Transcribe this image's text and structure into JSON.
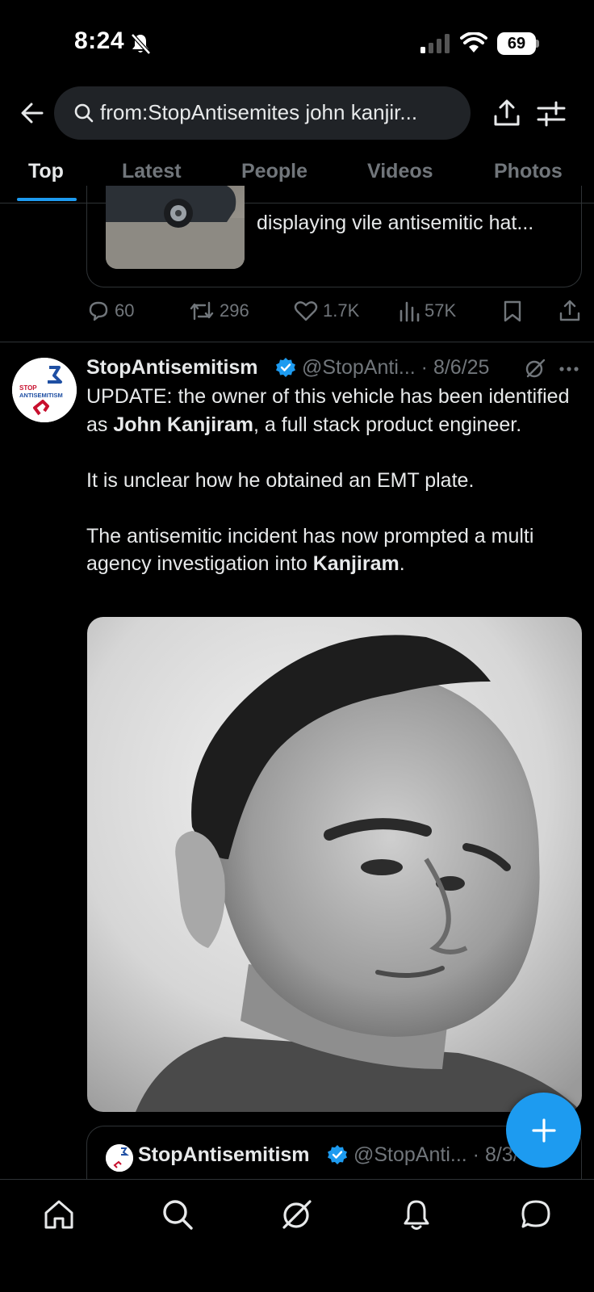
{
  "status_bar": {
    "time": "8:24",
    "battery": "69"
  },
  "search": {
    "query": "from:StopAntisemites john kanjir..."
  },
  "tabs": [
    {
      "label": "Top",
      "active": true
    },
    {
      "label": "Latest",
      "active": false
    },
    {
      "label": "People",
      "active": false
    },
    {
      "label": "Videos",
      "active": false
    },
    {
      "label": "Photos",
      "active": false
    }
  ],
  "previous_tweet": {
    "card_text": "displaying vile antisemitic hat...",
    "replies": "60",
    "reposts": "296",
    "likes": "1.7K",
    "views": "57K"
  },
  "tweet": {
    "display_name": "StopAntisemitism",
    "handle_date": "@StopAnti... · 8/6/25",
    "body": {
      "p1_a": "UPDATE: the owner of this vehicle has been identified as ",
      "p1_bold": "John Kanjiram",
      "p1_b": ", a full stack product engineer.",
      "p2": "It is unclear how he obtained an EMT plate.",
      "p3_a": "The antisemitic incident has now prompted a multi agency investigation into ",
      "p3_bold": "Kanjiram",
      "p3_b": "."
    },
    "avatar_text": [
      "STOP",
      "ANTISEMITISM"
    ]
  },
  "quoted_tweet": {
    "display_name": "StopAntisemitism",
    "handle_date": "@StopAnti... · 8/3/"
  },
  "icons": [
    "back-arrow-icon",
    "search-icon",
    "share-icon",
    "filter-icon",
    "verified-badge-icon",
    "grok-icon",
    "more-icon",
    "reply-icon",
    "repost-icon",
    "like-icon",
    "views-icon",
    "bookmark-icon",
    "home-icon",
    "explore-icon",
    "notifications-icon",
    "messages-icon",
    "plus-icon"
  ],
  "colors": {
    "accent": "#1d9bf0",
    "background": "#000000",
    "muted": "#71767b",
    "text": "#e7e9ea"
  }
}
